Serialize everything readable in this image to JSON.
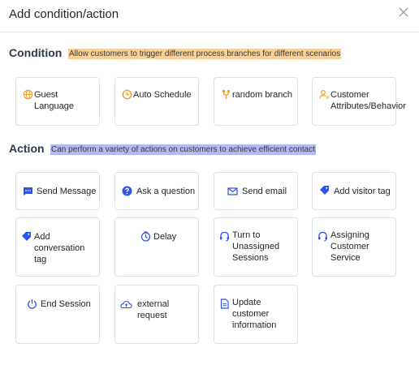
{
  "dialog": {
    "title": "Add condition/action"
  },
  "condition": {
    "title": "Condition",
    "hint": "Allow customers to trigger different process branches for different scenarios",
    "items": [
      {
        "label": "Guest\nLanguage",
        "icon": "globe-icon"
      },
      {
        "label": "Auto Schedule",
        "icon": "clock-icon"
      },
      {
        "label": "random branch",
        "icon": "branch-icon"
      },
      {
        "label": "Customer\nAttributes/Behavior",
        "icon": "user-attribute-icon"
      }
    ]
  },
  "action": {
    "title": "Action",
    "hint": "Can perform a variety of actions on customers to achieve efficient contact",
    "items": [
      {
        "label": "Send Message",
        "icon": "message-icon"
      },
      {
        "label": "Ask a question",
        "icon": "question-icon"
      },
      {
        "label": "Send email",
        "icon": "email-icon"
      },
      {
        "label": "Add visitor tag",
        "icon": "tag-icon"
      },
      {
        "label": "Add\nconversation\ntag",
        "icon": "tag-icon"
      },
      {
        "label": "Delay",
        "icon": "timer-icon"
      },
      {
        "label": "Turn to\nUnassigned\nSessions",
        "icon": "headset-icon"
      },
      {
        "label": "Assigning\nCustomer\nService",
        "icon": "headset-icon"
      },
      {
        "label": "End Session",
        "icon": "power-icon"
      },
      {
        "label": "external\nrequest",
        "icon": "cloud-icon"
      },
      {
        "label": "Update\ncustomer\ninformation",
        "icon": "document-icon"
      }
    ]
  },
  "colors": {
    "condition_icon": "#f0a020",
    "action_icon": "#2f54eb"
  }
}
